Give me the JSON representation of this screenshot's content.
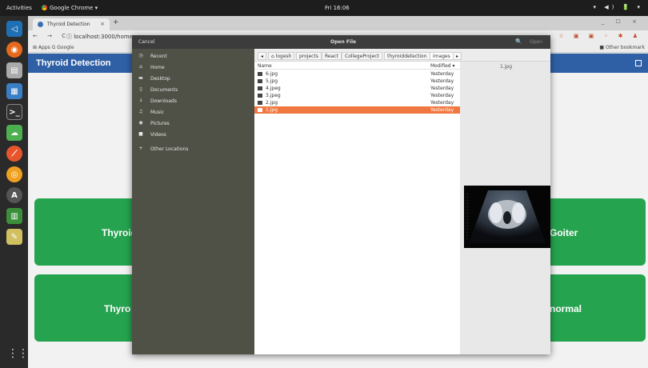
{
  "topbar": {
    "activities": "Activities",
    "app": "Google Chrome ▾",
    "clock": "Fri 16:06",
    "tray": "▾ ◀) 🔋 ▾"
  },
  "browser": {
    "tab_title": "Thyroid Detection",
    "tab_close": "×",
    "new_tab": "+",
    "window_controls": "_ ☐ ×",
    "nav_buttons": "← → C",
    "url": "ⓘ localhost:3000/home",
    "bookmarks_left": "⊞ Apps  G Google",
    "bookmarks_right": "■ Other bookmark"
  },
  "page": {
    "title": "Thyroid Detection",
    "cards": [
      "Thyroid",
      "Goiter",
      "Thyro",
      "normal"
    ]
  },
  "dialog": {
    "cancel": "Cancel",
    "title": "Open File",
    "search_icon": "🔍",
    "open": "Open",
    "places": [
      {
        "icon": "clock-icon",
        "glyph": "◷",
        "label": "Recent"
      },
      {
        "icon": "home-icon",
        "glyph": "⌂",
        "label": "Home"
      },
      {
        "icon": "folder-icon",
        "glyph": "▬",
        "label": "Desktop"
      },
      {
        "icon": "document-icon",
        "glyph": "▯",
        "label": "Documents"
      },
      {
        "icon": "download-icon",
        "glyph": "↓",
        "label": "Downloads"
      },
      {
        "icon": "music-icon",
        "glyph": "♫",
        "label": "Music"
      },
      {
        "icon": "camera-icon",
        "glyph": "◉",
        "label": "Pictures"
      },
      {
        "icon": "video-icon",
        "glyph": "■",
        "label": "Videos"
      },
      {
        "icon": "plus-icon",
        "glyph": "+",
        "label": "Other Locations"
      }
    ],
    "path": [
      "◂",
      "⌂ logesh",
      "projects",
      "React",
      "CollegeProject",
      "thyroiddetection",
      "images",
      "▸"
    ],
    "columns": {
      "name": "Name",
      "modified": "Modified ▾"
    },
    "files": [
      {
        "name": "6.jpg",
        "modified": "Yesterday"
      },
      {
        "name": "5.jpg",
        "modified": "Yesterday"
      },
      {
        "name": "4.jpeg",
        "modified": "Yesterday"
      },
      {
        "name": "3.jpeg",
        "modified": "Yesterday"
      },
      {
        "name": "2.jpg",
        "modified": "Yesterday"
      },
      {
        "name": "1.jpg",
        "modified": "Yesterday"
      }
    ],
    "preview_name": "1.jpg"
  },
  "colors": {
    "appbar": "#2f5fa5",
    "card": "#26a34f",
    "selection": "#f0773f",
    "sidebar": "#4f5046"
  }
}
